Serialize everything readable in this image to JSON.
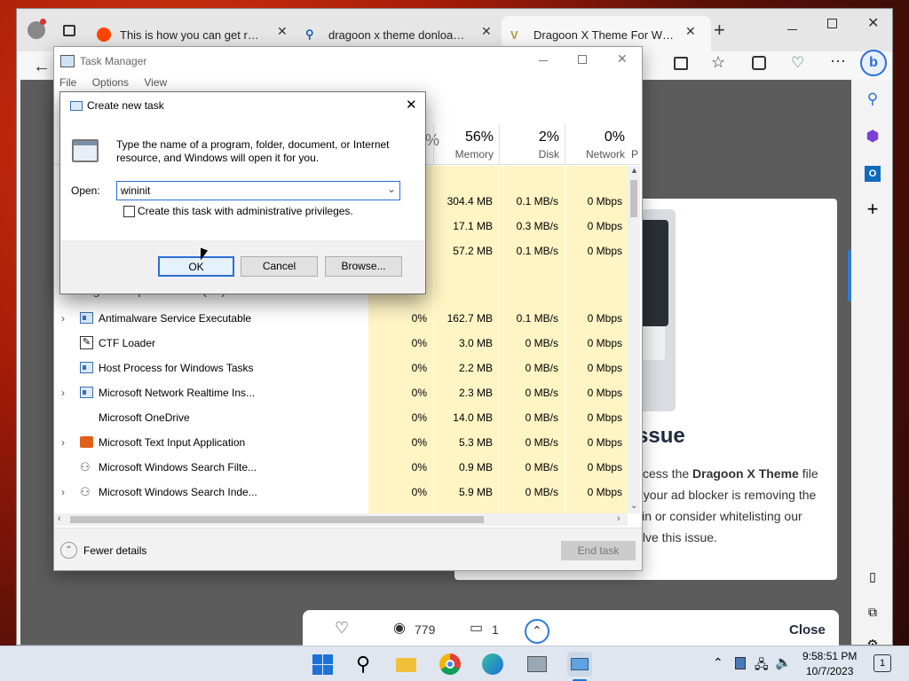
{
  "browser": {
    "tabs": [
      {
        "title": "This is how you can get rounde",
        "icon": "reddit-icon"
      },
      {
        "title": "dragoon x theme donload - Se",
        "icon": "search-icon"
      },
      {
        "title": "Dragoon X Theme For Window",
        "icon": "dragoon-icon"
      }
    ],
    "new_tab": "+"
  },
  "page": {
    "heading": "ssue",
    "body_pre": "ccess the ",
    "body_bold": "Dragoon X Theme",
    "body_post": " file",
    "line2": "t your ad blocker is removing the",
    "line3": "download link. Please try again or consider whitelisting our",
    "line4": "site in your ad blocker to resolve this issue.",
    "close_label": "Close",
    "views": "779",
    "comments": "1"
  },
  "task_manager": {
    "title": "Task Manager",
    "menu": [
      "File",
      "Options",
      "View"
    ],
    "columns": [
      {
        "pct": "56%",
        "name": "Memory"
      },
      {
        "pct": "2%",
        "name": "Disk"
      },
      {
        "pct": "0%",
        "name": "Network"
      },
      {
        "pct": "",
        "name": "P"
      }
    ],
    "apps_rows": [
      {
        "memory": "304.4 MB",
        "disk": "0.1 MB/s",
        "network": "0 Mbps"
      },
      {
        "memory": "17.1 MB",
        "disk": "0.3 MB/s",
        "network": "0 Mbps"
      },
      {
        "memory": "57.2 MB",
        "disk": "0.1 MB/s",
        "network": "0 Mbps"
      }
    ],
    "bg_group": "Background processes (23)",
    "processes": [
      {
        "name": "Antimalware Service Executable",
        "cpu": "0%",
        "memory": "162.7 MB",
        "disk": "0.1 MB/s",
        "network": "0 Mbps",
        "expand": true,
        "icon": "service-icon"
      },
      {
        "name": "CTF Loader",
        "cpu": "0%",
        "memory": "3.0 MB",
        "disk": "0 MB/s",
        "network": "0 Mbps",
        "expand": false,
        "icon": "pen-icon"
      },
      {
        "name": "Host Process for Windows Tasks",
        "cpu": "0%",
        "memory": "2.2 MB",
        "disk": "0 MB/s",
        "network": "0 Mbps",
        "expand": false,
        "icon": "service-icon"
      },
      {
        "name": "Microsoft Network Realtime Ins...",
        "cpu": "0%",
        "memory": "2.3 MB",
        "disk": "0 MB/s",
        "network": "0 Mbps",
        "expand": true,
        "icon": "service-icon"
      },
      {
        "name": "Microsoft OneDrive",
        "cpu": "0%",
        "memory": "14.0 MB",
        "disk": "0 MB/s",
        "network": "0 Mbps",
        "expand": false,
        "icon": ""
      },
      {
        "name": "Microsoft Text Input Application",
        "cpu": "0%",
        "memory": "5.3 MB",
        "disk": "0 MB/s",
        "network": "0 Mbps",
        "expand": true,
        "icon": "keyboard-icon"
      },
      {
        "name": "Microsoft Windows Search Filte...",
        "cpu": "0%",
        "memory": "0.9 MB",
        "disk": "0 MB/s",
        "network": "0 Mbps",
        "expand": false,
        "icon": "search-user-icon"
      },
      {
        "name": "Microsoft Windows Search Inde...",
        "cpu": "0%",
        "memory": "5.9 MB",
        "disk": "0 MB/s",
        "network": "0 Mbps",
        "expand": true,
        "icon": "search-user-icon"
      }
    ],
    "fewer_details": "Fewer details",
    "end_task": "End task"
  },
  "dialog": {
    "title": "Create new task",
    "description": "Type the name of a program, folder, document, or Internet resource, and Windows will open it for you.",
    "open_label": "Open:",
    "open_value": "wininit",
    "admin_label": "Create this task with administrative privileges.",
    "ok": "OK",
    "cancel": "Cancel",
    "browse": "Browse..."
  },
  "taskbar": {
    "time": "9:58:51 PM",
    "date": "10/7/2023",
    "notifications": "1"
  }
}
